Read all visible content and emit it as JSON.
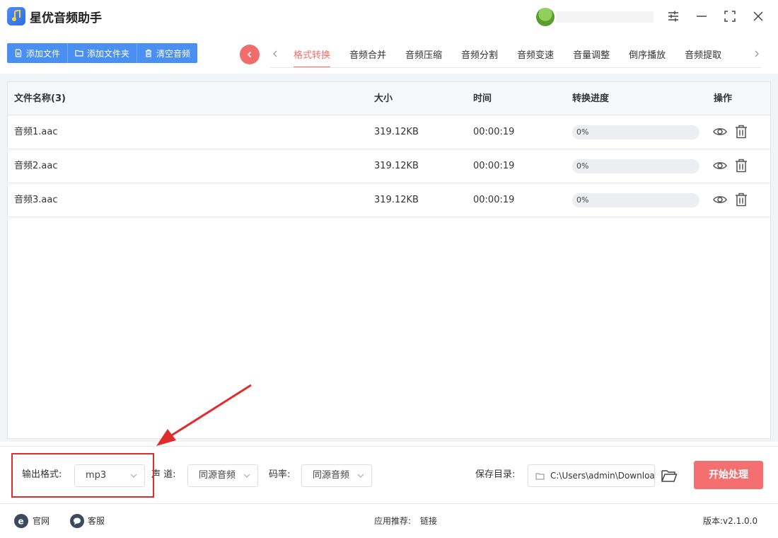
{
  "app": {
    "title": "星优音频助手"
  },
  "toolbar": {
    "add_file": "添加文件",
    "add_folder": "添加文件夹",
    "clear_audio": "清空音频"
  },
  "tabs": [
    {
      "label": "格式转换",
      "active": true
    },
    {
      "label": "音频合并"
    },
    {
      "label": "音频压缩"
    },
    {
      "label": "音频分割"
    },
    {
      "label": "音频变速"
    },
    {
      "label": "音量调整"
    },
    {
      "label": "倒序播放"
    },
    {
      "label": "音频提取"
    }
  ],
  "table": {
    "headers": {
      "name": "文件名称(3)",
      "size": "大小",
      "time": "时间",
      "progress": "转换进度",
      "actions": "操作"
    },
    "rows": [
      {
        "name": "音频1.aac",
        "size": "319.12KB",
        "time": "00:00:19",
        "progress_text": "0%",
        "progress": 0
      },
      {
        "name": "音频2.aac",
        "size": "319.12KB",
        "time": "00:00:19",
        "progress_text": "0%",
        "progress": 0
      },
      {
        "name": "音频3.aac",
        "size": "319.12KB",
        "time": "00:00:19",
        "progress_text": "0%",
        "progress": 0
      }
    ]
  },
  "settings": {
    "output_format_label": "输出格式:",
    "output_format_value": "mp3",
    "channel_label": "声 道:",
    "channel_value": "同源音频",
    "bitrate_label": "码率:",
    "bitrate_value": "同源音频",
    "save_dir_label": "保存目录:",
    "save_dir_value": "C:\\Users\\admin\\Downloads",
    "start_button": "开始处理"
  },
  "footer": {
    "website": "官网",
    "support": "客服",
    "recommend_label": "应用推荐:",
    "recommend_link": "链接",
    "version": "版本:v2.1.0.0"
  },
  "colors": {
    "primary": "#4a8ff2",
    "accent": "#f16d6d",
    "highlight": "#e02c2c"
  }
}
